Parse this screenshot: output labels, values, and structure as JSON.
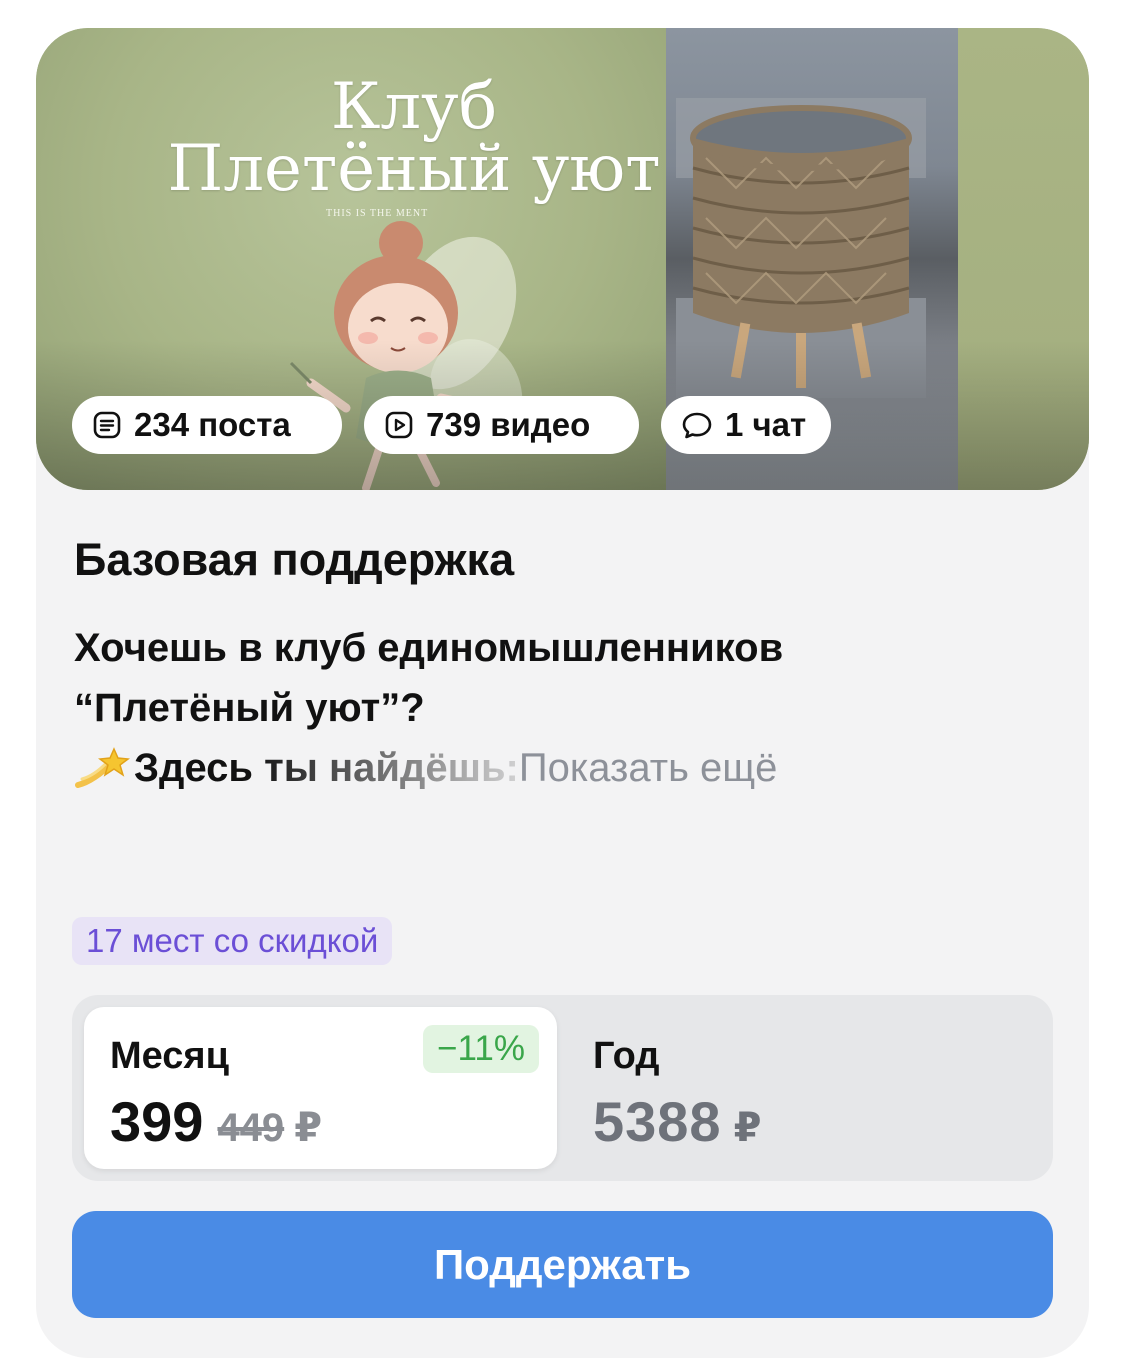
{
  "cover": {
    "title_line1": "Клуб",
    "title_line2": "Плетёный уют",
    "subtitle_fragment": "THIS IS THE         MENT",
    "chips": {
      "posts": "234 поста",
      "videos": "739 видео",
      "chats": "1 чат"
    }
  },
  "tier": {
    "title": "Базовая поддержка",
    "description_line1": "Хочешь в клуб единомышленников",
    "description_line2": "“Плетёный уют”?",
    "description_line3": "Здесь ты найдёшь:",
    "show_more": "Показать ещё",
    "description_icon": "dizzy-comet-emoji"
  },
  "discount": {
    "badge": "17 мест со скидкой"
  },
  "pricing": {
    "month": {
      "label": "Месяц",
      "percent": "−11%",
      "price": "399",
      "old_price": "449",
      "currency": "₽",
      "selected": true
    },
    "year": {
      "label": "Год",
      "price": "5388",
      "currency": "₽",
      "selected": false
    }
  },
  "button": {
    "label": "Поддержать"
  },
  "colors": {
    "accent_button": "#4a8be5",
    "discount_text": "#6b4fd6",
    "discount_bg": "#e8e3f6",
    "percent_text": "#3aa64a",
    "percent_bg": "#e2f4e1"
  }
}
